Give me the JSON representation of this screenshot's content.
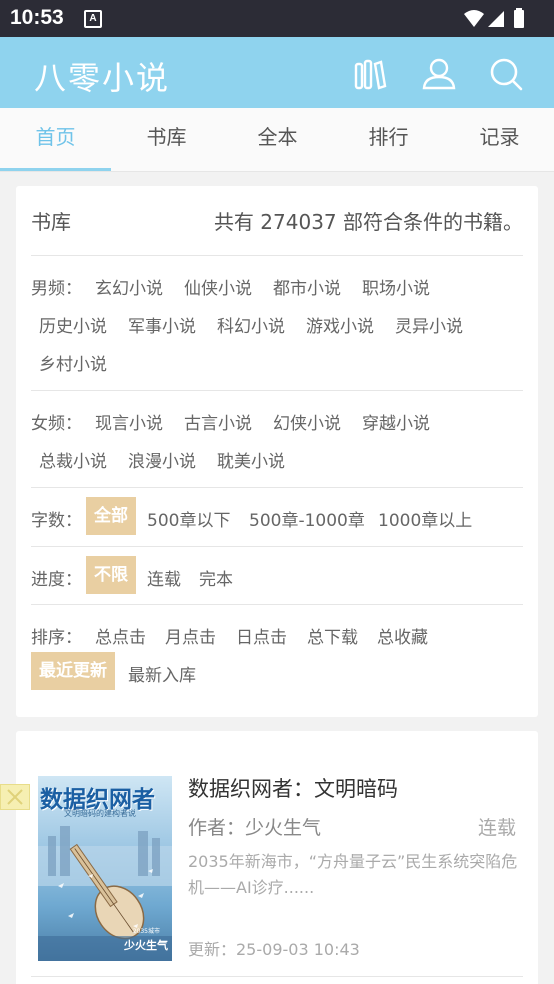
{
  "status_bar": {
    "time": "10:53",
    "notification_icon": "A"
  },
  "app": {
    "logo": "八零小说",
    "header_color": "#8fd3ee"
  },
  "tabs": [
    {
      "label": "首页",
      "active": true
    },
    {
      "label": "书库",
      "active": false
    },
    {
      "label": "全本",
      "active": false
    },
    {
      "label": "排行",
      "active": false
    },
    {
      "label": "记录",
      "active": false
    }
  ],
  "library": {
    "title": "书库",
    "count_text": "共有 274037 部符合条件的书籍。",
    "male": {
      "label": "男频：",
      "options": [
        "玄幻小说",
        "仙侠小说",
        "都市小说",
        "职场小说",
        "历史小说",
        "军事小说",
        "科幻小说",
        "游戏小说",
        "灵异小说",
        "乡村小说"
      ]
    },
    "female": {
      "label": "女频：",
      "options": [
        "现言小说",
        "古言小说",
        "幻侠小说",
        "穿越小说",
        "总裁小说",
        "浪漫小说",
        "耽美小说"
      ]
    },
    "words": {
      "label": "字数：",
      "options": [
        "全部",
        "500章以下",
        "500章-1000章",
        "1000章以上"
      ],
      "selected": "全部"
    },
    "progress": {
      "label": "进度：",
      "options": [
        "不限",
        "连载",
        "完本"
      ],
      "selected": "不限"
    },
    "sort": {
      "label": "排序：",
      "options": [
        "总点击",
        "月点击",
        "日点击",
        "总下载",
        "总收藏",
        "最近更新",
        "最新入库"
      ],
      "selected": "最近更新"
    },
    "selected_color": "#e9cfa2"
  },
  "book": {
    "title": "数据织网者：文明暗码",
    "author": "作者：少火生气",
    "status": "连载",
    "description": "2035年新海市，“方舟量子云”民生系统突陷危机——AI诊疗......",
    "updated": "更新：25-09-03 10:43",
    "cover": {
      "title": "数据织网者",
      "subtitle": "文明暗码的建构者说",
      "author": "少火生气",
      "year": "2035城市"
    }
  }
}
